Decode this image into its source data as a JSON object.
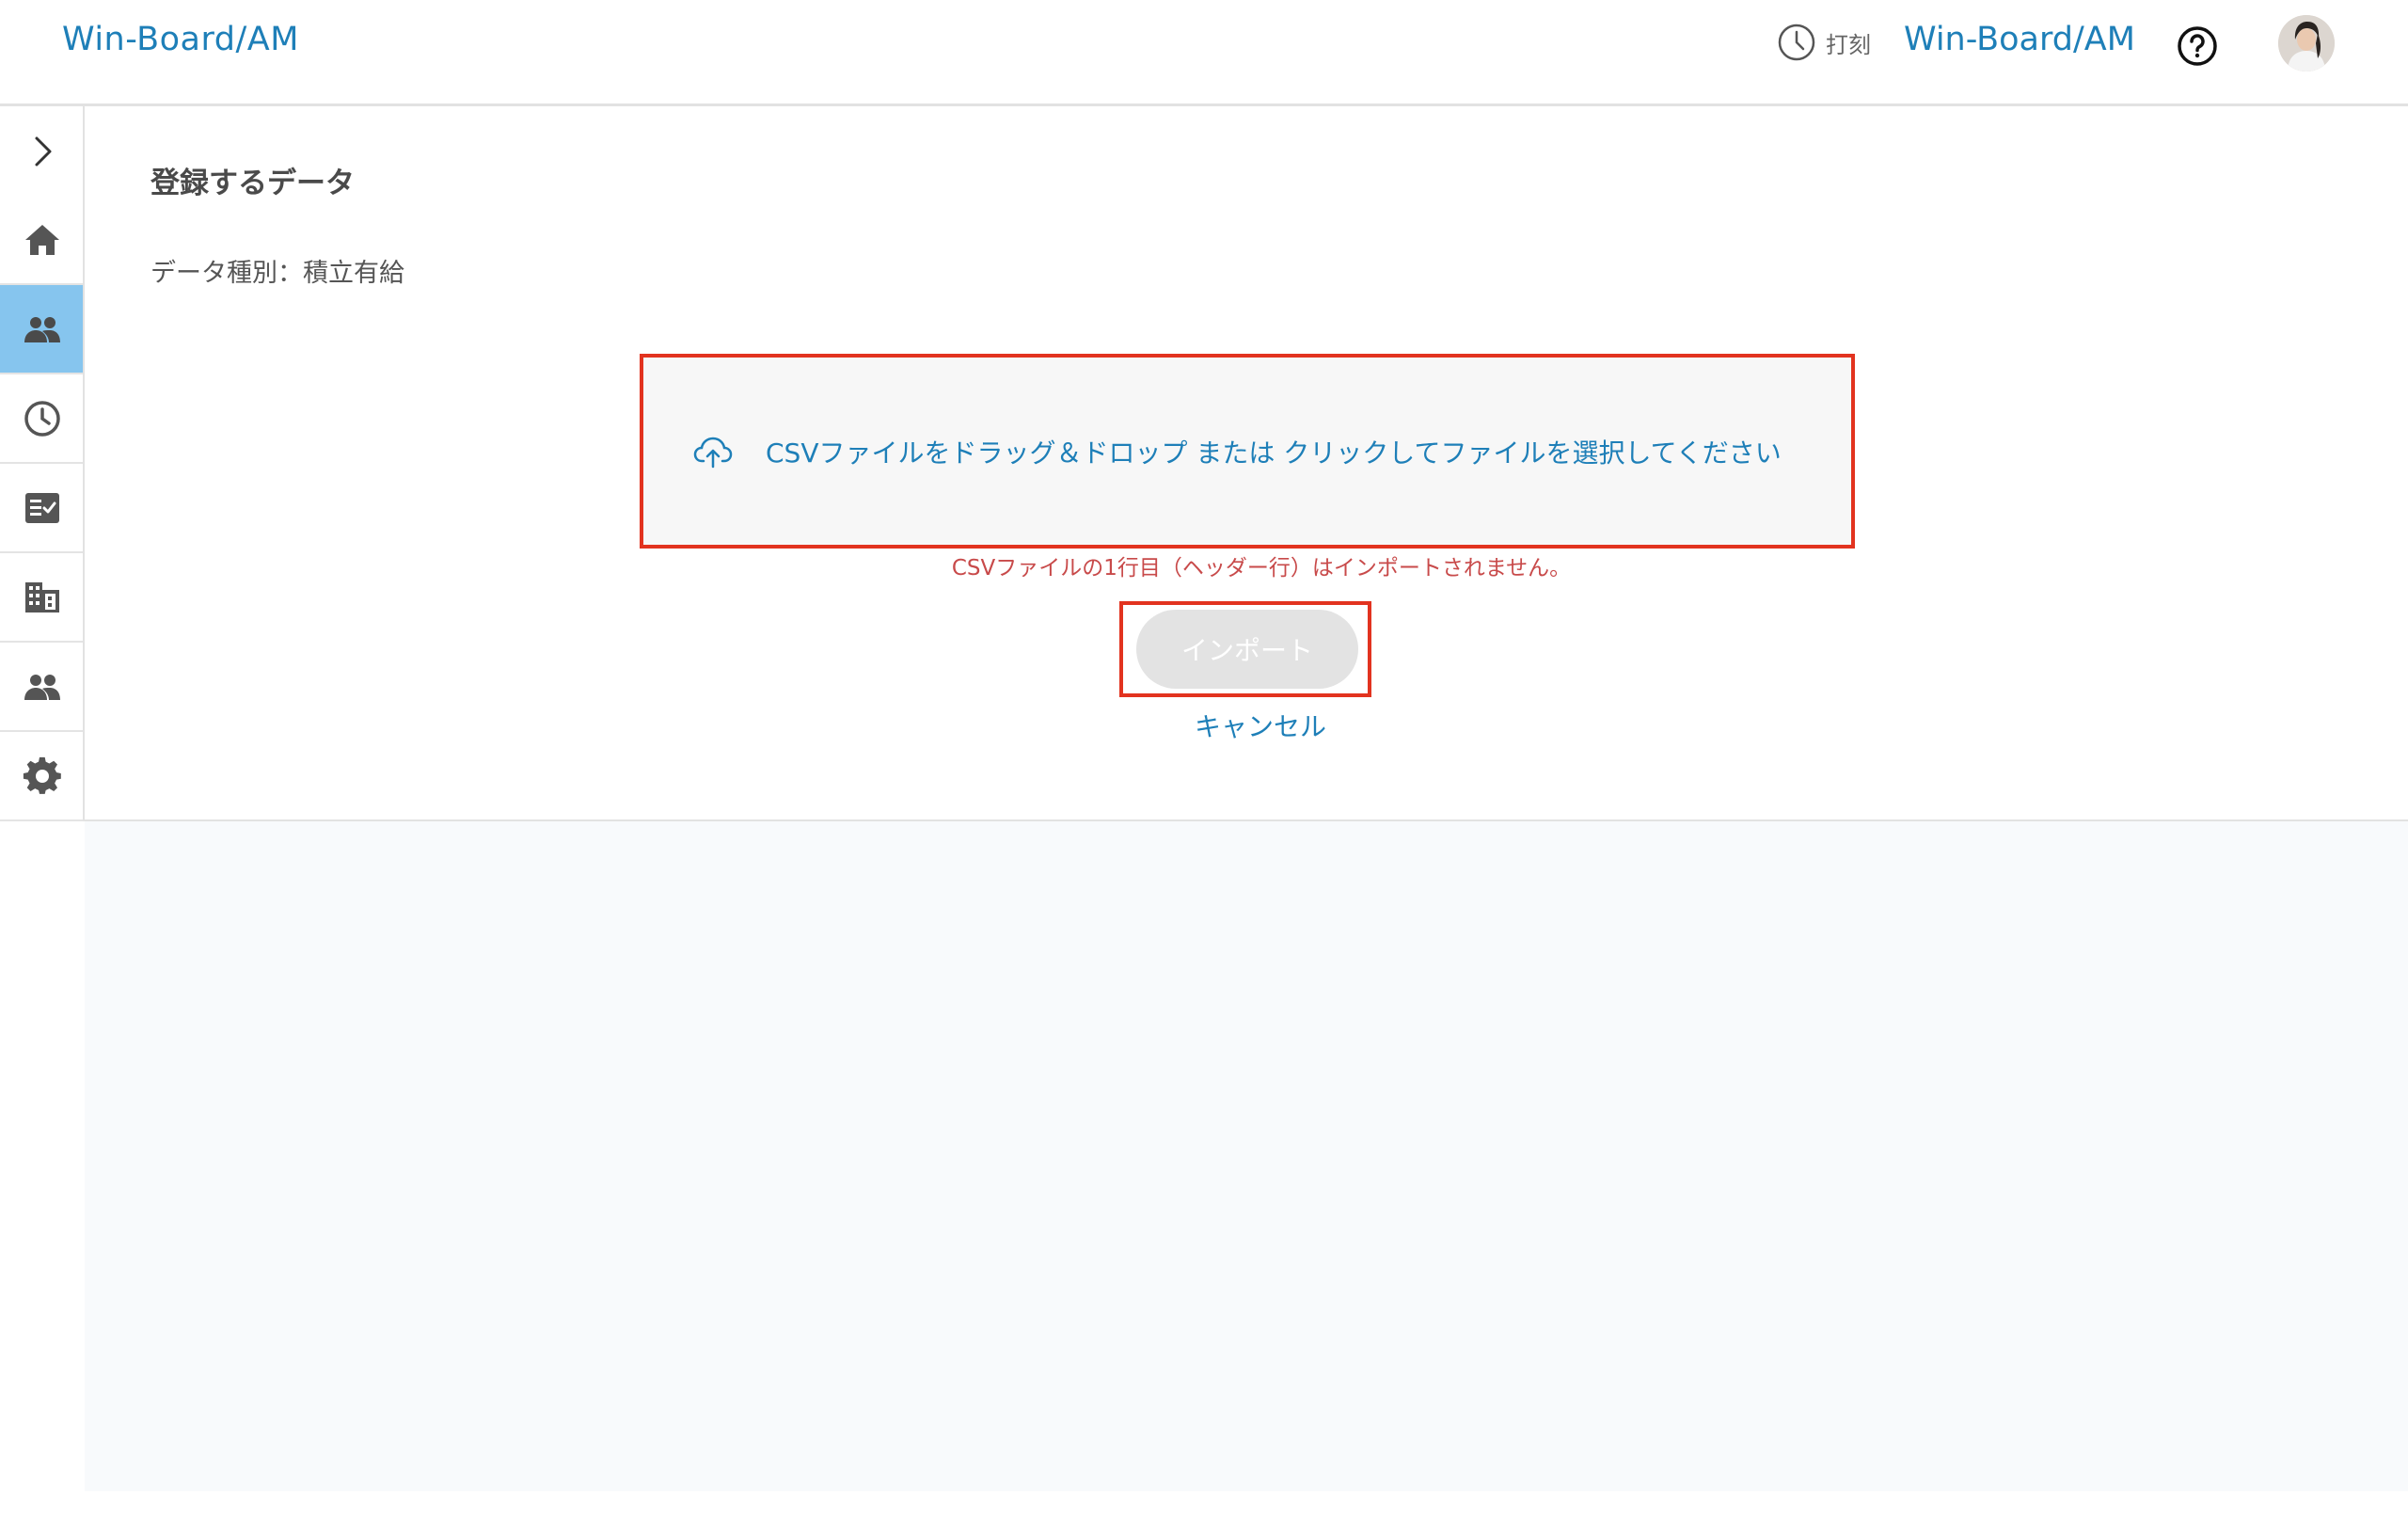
{
  "header": {
    "logo": "Win-Board/AM",
    "clock_label": "打刻",
    "product_name": "Win-Board/AM",
    "help_icon": "help-circle-icon",
    "avatar_icon": "user-avatar"
  },
  "sidebar": {
    "toggle_icon": "chevron-right-icon",
    "items": [
      {
        "icon": "home-icon",
        "active": false
      },
      {
        "icon": "people-icon",
        "active": true
      },
      {
        "icon": "clock-icon",
        "active": false
      },
      {
        "icon": "checklist-icon",
        "active": false
      },
      {
        "icon": "building-icon",
        "active": false
      },
      {
        "icon": "group-icon",
        "active": false
      },
      {
        "icon": "gear-icon",
        "active": false
      }
    ]
  },
  "main": {
    "section_title": "登録するデータ",
    "data_type": "データ種別：積立有給",
    "dropzone_text": "CSVファイルをドラッグ＆ドロップ または クリックしてファイルを選択してください",
    "notice": "CSVファイルの1行目（ヘッダー行）はインポートされません。",
    "import_label": "インポート",
    "cancel_label": "キャンセル"
  },
  "colors": {
    "accent": "#1e7fb8",
    "active_nav": "#86c5ee",
    "highlight_border": "#e2331f",
    "warning_text": "#c84a4a"
  }
}
